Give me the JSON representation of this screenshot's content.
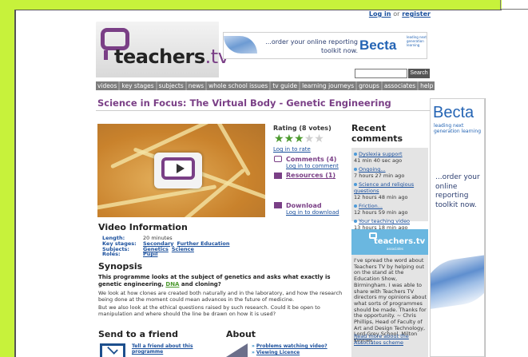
{
  "header": {
    "login_label": "Log in",
    "or_label": "or",
    "register_label": "register",
    "logo_word": "teachers",
    "logo_tv": ".tv",
    "search_placeholder": "",
    "search_button": "Search"
  },
  "top_ad": {
    "text": "...order your online reporting toolkit now.",
    "brand": "Becta",
    "tagline": "leading next generation learning"
  },
  "nav": {
    "items": [
      "videos",
      "key stages",
      "subjects",
      "news",
      "whole school issues",
      "tv guide",
      "learning journeys",
      "groups",
      "associates",
      "help"
    ]
  },
  "page": {
    "title": "Science in Focus: The Virtual Body - Genetic Engineering"
  },
  "rating": {
    "label": "Rating (8 votes)",
    "stars_filled": 3,
    "stars_total": 5,
    "login_to_rate": "Log in to rate"
  },
  "actions": {
    "comments_label": "Comments (4)",
    "comments_link": "Log in to comment",
    "resources_label": "Resources (1)",
    "download_label": "Download",
    "download_link": "Log in to download"
  },
  "recent": {
    "title": "Recent comments",
    "items": [
      {
        "title": "Dyslexia support",
        "time": "41 min 40 sec ago"
      },
      {
        "title": "Ongoing...",
        "time": "7 hours 27 min ago"
      },
      {
        "title": "Science and religious questions",
        "time": "12 hours 48 min ago"
      },
      {
        "title": "Friction...",
        "time": "12 hours 59 min ago"
      },
      {
        "title": "Your teaching video",
        "time": "13 hours 18 min ago"
      }
    ]
  },
  "associates": {
    "logo_word": "teachers.tv",
    "logo_sub": "associates",
    "quote": "I've spread the word about Teachers TV by helping out on the stand at the Education Show, Birmingham. I was able to share with Teachers TV directors my opinions about what sorts of programmes should be made. Thanks for the opportunity. ~ Chris Phillips, Head of Faculty of Art and Design Technology, Lord Grey School, Milton Keynes",
    "link": "Read more about the Associates scheme"
  },
  "video_info": {
    "title": "Video Information",
    "length_label": "Length:",
    "length_value": "20 minutes",
    "key_stages_label": "Key stages:",
    "key_stages": [
      "Secondary",
      "Further Education"
    ],
    "subjects_label": "Subjects:",
    "subjects": [
      "Genetics",
      "Science"
    ],
    "roles_label": "Roles:",
    "roles": [
      "Pupil"
    ]
  },
  "synopsis": {
    "title": "Synopsis",
    "lead_before": "This programme looks at the subject of genetics and asks what exactly is genetic engineering, ",
    "lead_dna": "DNA",
    "lead_after": " and cloning?",
    "p1": "We look at how clones are created both naturally and in the laboratory, and how the research being done at the moment could mean advances in the future of medicine.",
    "p2": "But we also look at the ethical questions raised by such research. Could it be open to manipulation and where should the line be drawn on how it is used?"
  },
  "send": {
    "title": "Send to a friend",
    "link": "Tell a friend about this programme"
  },
  "about": {
    "title": "About",
    "links": [
      "Problems watching video?",
      "Viewing Licence"
    ]
  },
  "right_ad": {
    "brand": "Becta",
    "tagline": "leading next generation learning",
    "cta": "...order your online reporting toolkit now."
  },
  "colors": {
    "lime": "#c7f23b",
    "purple": "#7a3f86",
    "link": "#1a4f9c",
    "star_on": "#4d9a2f"
  }
}
